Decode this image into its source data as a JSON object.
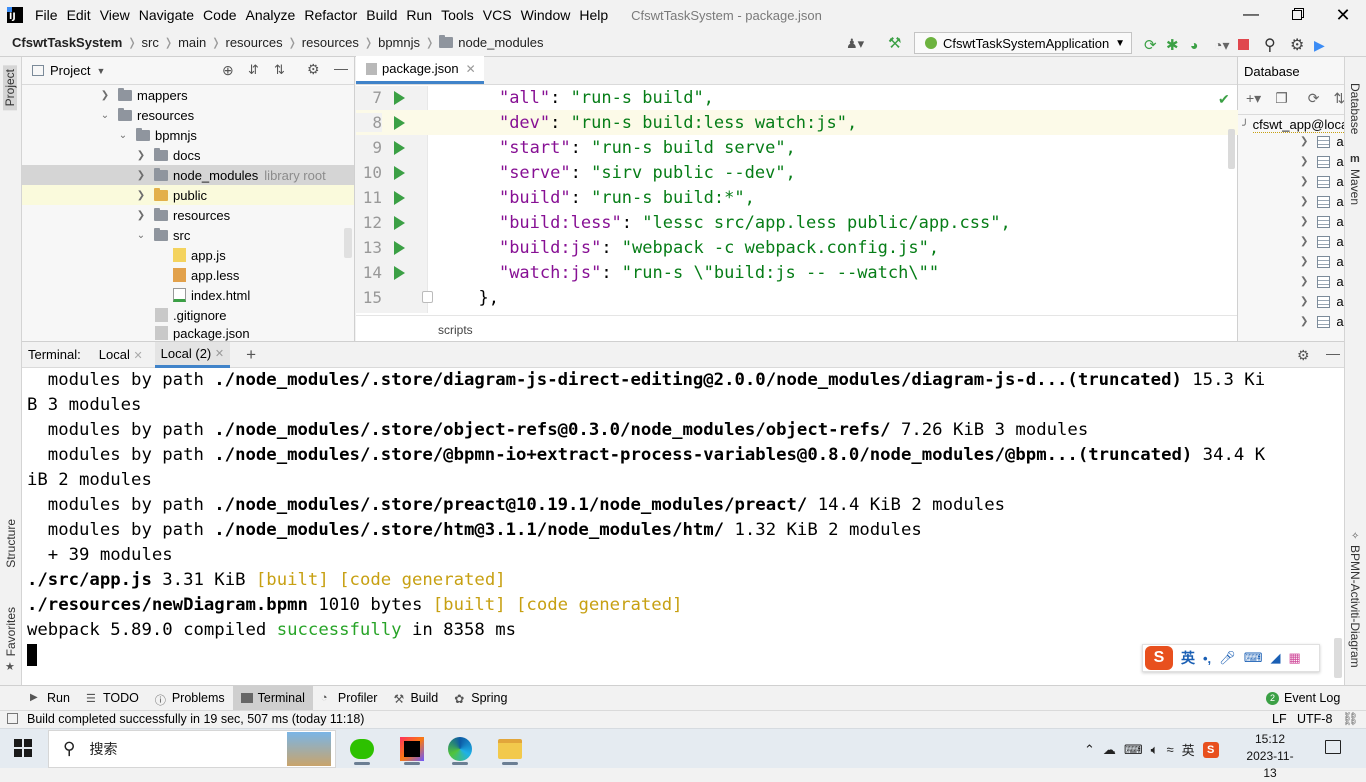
{
  "menubar": {
    "items": [
      "File",
      "Edit",
      "View",
      "Navigate",
      "Code",
      "Analyze",
      "Refactor",
      "Build",
      "Run",
      "Tools",
      "VCS",
      "Window",
      "Help"
    ],
    "window_title": "CfswtTaskSystem - package.json"
  },
  "breadcrumb": {
    "project": "CfswtTaskSystem",
    "items": [
      "src",
      "main",
      "resources",
      "resources",
      "bpmnjs",
      "node_modules"
    ]
  },
  "run_config": {
    "label": "CfswtTaskSystemApplication"
  },
  "left_stripe": {
    "project": "Project",
    "structure": "Structure",
    "favorites": "Favorites"
  },
  "right_stripe": {
    "database": "Database",
    "maven": "Maven",
    "bpmn": "BPMN-Activiti-Diagram"
  },
  "project_panel": {
    "title": "Project",
    "tree": [
      {
        "label": "mappers",
        "type": "folder"
      },
      {
        "label": "resources",
        "type": "folder"
      },
      {
        "label": "bpmnjs",
        "type": "folder"
      },
      {
        "label": "docs",
        "type": "folder"
      },
      {
        "label": "node_modules",
        "type": "folder",
        "hint": "library root"
      },
      {
        "label": "public",
        "type": "folder"
      },
      {
        "label": "resources",
        "type": "folder"
      },
      {
        "label": "src",
        "type": "folder"
      },
      {
        "label": "app.js",
        "type": "js"
      },
      {
        "label": "app.less",
        "type": "less"
      },
      {
        "label": "index.html",
        "type": "html"
      },
      {
        "label": ".gitignore",
        "type": "file"
      },
      {
        "label": "package.json",
        "type": "json"
      }
    ]
  },
  "editor": {
    "tab": "package.json",
    "footer_breadcrumb": "scripts",
    "lines": [
      {
        "num": "7",
        "key": "\"all\"",
        "val": "\"run-s build\","
      },
      {
        "num": "8",
        "key": "\"dev\"",
        "val": "\"run-s build:less watch:js\","
      },
      {
        "num": "9",
        "key": "\"start\"",
        "val": "\"run-s build serve\","
      },
      {
        "num": "10",
        "key": "\"serve\"",
        "val": "\"sirv public --dev\","
      },
      {
        "num": "11",
        "key": "\"build\"",
        "val": "\"run-s build:*\","
      },
      {
        "num": "12",
        "key": "\"build:less\"",
        "val": "\"lessc src/app.less public/app.css\","
      },
      {
        "num": "13",
        "key": "\"build:js\"",
        "val": "\"webpack -c webpack.config.js\","
      },
      {
        "num": "14",
        "key": "\"watch:js\"",
        "val": "\"run-s \\\"build:js -- --watch\\\"\""
      },
      {
        "num": "15",
        "key": "},",
        "val": ""
      }
    ]
  },
  "database_panel": {
    "title": "Database",
    "connection": "cfswt_app@localhost",
    "table_count": 10,
    "table_label": "a"
  },
  "terminal": {
    "label": "Terminal:",
    "tabs": [
      "Local",
      "Local (2)"
    ],
    "lines": [
      {
        "pre": "  modules by path ",
        "bold": "./node_modules/.store/diagram-js-direct-editing@2.0.0/node_modules/diagram-js-d...(truncated)",
        "post": " 15.3 Ki"
      },
      {
        "pre": "B 3 modules",
        "bold": "",
        "post": ""
      },
      {
        "pre": "  modules by path ",
        "bold": "./node_modules/.store/object-refs@0.3.0/node_modules/object-refs/",
        "post": " 7.26 KiB 3 modules"
      },
      {
        "pre": "  modules by path ",
        "bold": "./node_modules/.store/@bpmn-io+extract-process-variables@0.8.0/node_modules/@bpm...(truncated)",
        "post": " 34.4 K"
      },
      {
        "pre": "iB 2 modules",
        "bold": "",
        "post": ""
      },
      {
        "pre": "  modules by path ",
        "bold": "./node_modules/.store/preact@10.19.1/node_modules/preact/",
        "post": " 14.4 KiB 2 modules"
      },
      {
        "pre": "  modules by path ",
        "bold": "./node_modules/.store/htm@3.1.1/node_modules/htm/",
        "post": " 1.32 KiB 2 modules"
      },
      {
        "pre": "  + 39 modules",
        "bold": "",
        "post": ""
      }
    ],
    "built_line_1": {
      "file": "./src/app.js",
      "size": " 3.31 KiB ",
      "tag1": "[built]",
      "tag2": "[code generated]"
    },
    "built_line_2": {
      "file": "./resources/newDiagram.bpmn",
      "size": " 1010 bytes ",
      "tag1": "[built]",
      "tag2": "[code generated]"
    },
    "final": {
      "pre": "webpack 5.89.0 compiled ",
      "success": "successfully",
      "post": " in 8358 ms"
    }
  },
  "tool_windows": [
    "Run",
    "TODO",
    "Problems",
    "Terminal",
    "Profiler",
    "Build",
    "Spring"
  ],
  "event_log": {
    "count": "2",
    "label": "Event Log"
  },
  "status": {
    "message": "Build completed successfully in 19 sec, 507 ms (today 11:18)",
    "line_sep": "LF",
    "encoding": "UTF-8"
  },
  "ime": {
    "lang": "英"
  },
  "taskbar": {
    "search_placeholder": "搜索",
    "time": "15:12",
    "date": "2023-11-13",
    "tray_ime": "英"
  },
  "colors": {
    "accent": "#4083c9",
    "run_green": "#3ba045",
    "string": "#067d17",
    "key": "#871094",
    "success": "#28a428",
    "built": "#c7a012"
  }
}
